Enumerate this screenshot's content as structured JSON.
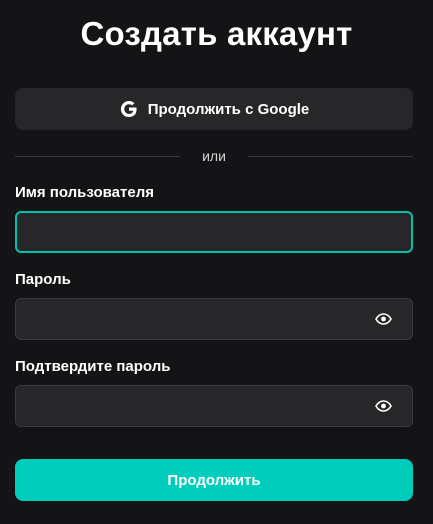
{
  "page": {
    "title": "Создать аккаунт"
  },
  "google_button": {
    "label": "Продолжить с Google",
    "icon": "google-g-icon"
  },
  "divider": {
    "text": "или"
  },
  "username": {
    "label": "Имя пользователя",
    "value": "",
    "placeholder": "",
    "state": "focused"
  },
  "password": {
    "label": "Пароль",
    "value": "",
    "placeholder": "",
    "icon": "eye-icon"
  },
  "confirm_password": {
    "label": "Подтвердите пароль",
    "value": "",
    "placeholder": "",
    "icon": "eye-icon"
  },
  "submit_button": {
    "label": "Продолжить"
  },
  "colors": {
    "background": "#141416",
    "surface": "#27272a",
    "accent": "#00cdbc",
    "focus_border": "#00c2ad"
  }
}
